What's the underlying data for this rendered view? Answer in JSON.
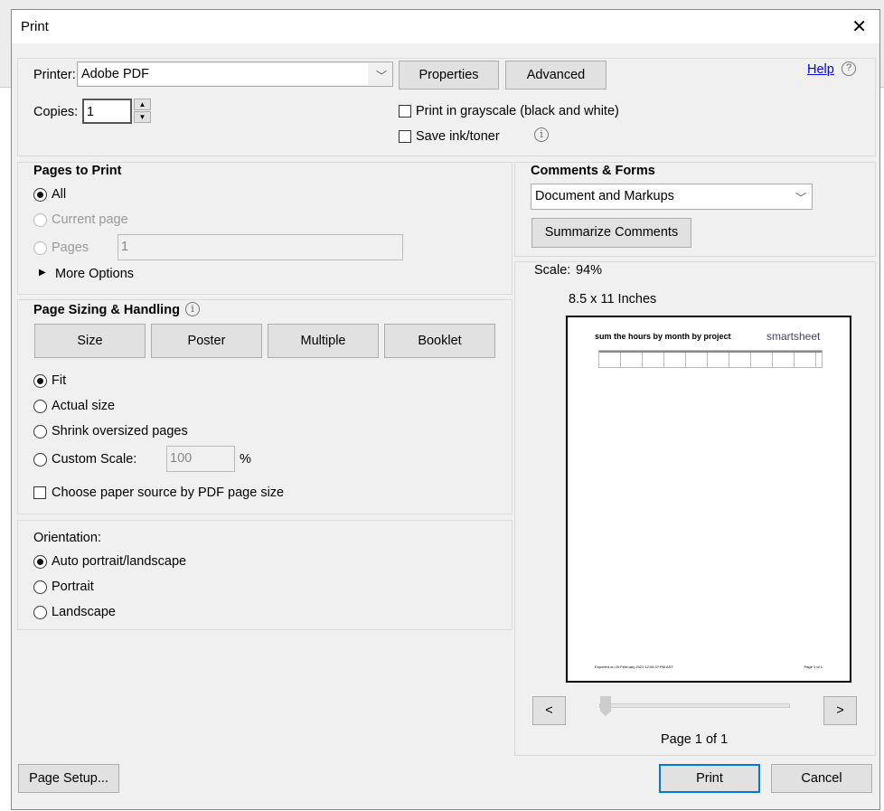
{
  "dialog": {
    "title": "Print",
    "close_icon": "close-icon"
  },
  "printer": {
    "label": "Printer:",
    "value": "Adobe PDF",
    "properties": "Properties",
    "advanced": "Advanced",
    "help": "Help",
    "copies_label": "Copies:",
    "copies": "1",
    "grayscale": "Print in grayscale (black and white)",
    "grayscale_checked": false,
    "save_ink": "Save ink/toner",
    "save_ink_checked": false
  },
  "pages": {
    "heading": "Pages to Print",
    "all": "All",
    "current": "Current page",
    "pages": "Pages",
    "pages_value": "1",
    "more": "More Options",
    "selected": "All"
  },
  "sizing": {
    "heading": "Page Sizing & Handling",
    "tabs": [
      "Size",
      "Poster",
      "Multiple",
      "Booklet"
    ],
    "fit": "Fit",
    "actual": "Actual size",
    "shrink": "Shrink oversized pages",
    "custom": "Custom Scale:",
    "custom_value": "100",
    "percent": "%",
    "paper_source": "Choose paper source by PDF page size",
    "selected": "Fit"
  },
  "orientation": {
    "heading": "Orientation:",
    "auto": "Auto portrait/landscape",
    "portrait": "Portrait",
    "landscape": "Landscape",
    "selected": "Auto portrait/landscape"
  },
  "comments": {
    "heading": "Comments & Forms",
    "value": "Document and Markups",
    "summarize": "Summarize Comments"
  },
  "preview": {
    "scale_label": "Scale:",
    "scale": "94%",
    "paper": "8.5 x 11 Inches",
    "doc_title": "sum the hours by month by project",
    "logo": "smartsheet",
    "footer_left": "Exported on 20 February 2021 12:05:37 PM AST",
    "footer_right": "Page 1 of 1",
    "prev": "<",
    "next": ">",
    "page_status": "Page 1 of 1",
    "slider_position": 0
  },
  "footer": {
    "page_setup": "Page Setup...",
    "print": "Print",
    "cancel": "Cancel"
  }
}
